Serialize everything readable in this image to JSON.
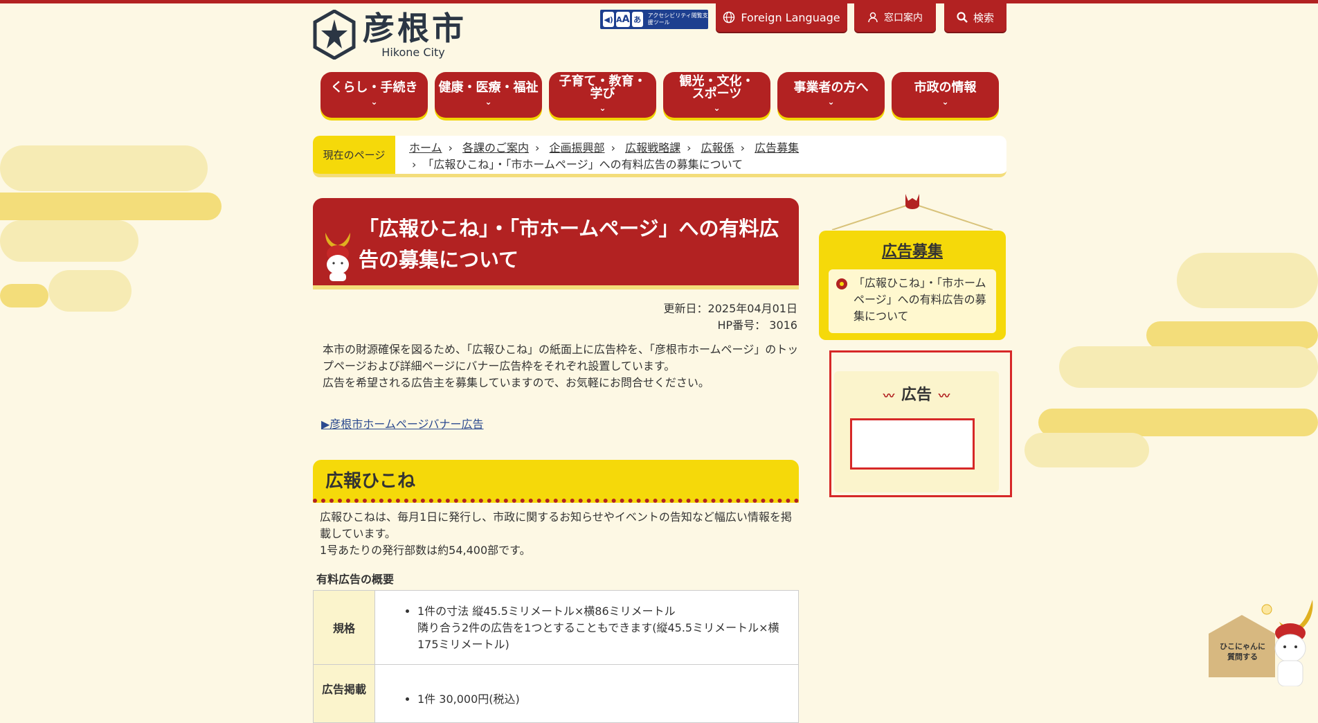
{
  "site": {
    "name_jp": "彦根市",
    "name_en": "Hikone City"
  },
  "header": {
    "a11y_label": "アクセシビリティ閲覧支援ツール",
    "a11y_icon_a": "A",
    "a11y_icon_a2": "A",
    "a11y_icon_kana": "あ",
    "foreign_language": "Foreign Language",
    "counter_guide": "窓口案内",
    "search": "検索"
  },
  "nav": [
    {
      "line1": "くらし・手続き",
      "line2": ""
    },
    {
      "line1": "健康・医療・福祉",
      "line2": ""
    },
    {
      "line1": "子育て・教育・",
      "line2": "学び"
    },
    {
      "line1": "観光・文化・",
      "line2": "スポーツ"
    },
    {
      "line1": "事業者の方へ",
      "line2": ""
    },
    {
      "line1": "市政の情報",
      "line2": ""
    }
  ],
  "breadcrumb": {
    "label": "現在のページ",
    "items": [
      "ホーム",
      "各課のご案内",
      "企画振興部",
      "広報戦略課",
      "広報係",
      "広告募集"
    ],
    "current": "「広報ひこね」・「市ホームページ」への有料広告の募集について"
  },
  "page": {
    "title": "「広報ひこね」・「市ホームページ」への有料広告の募集について",
    "updated": "更新日：2025年04月01日",
    "hp_number": "HP番号： 3016",
    "intro_1": "本市の財源確保を図るため、「広報ひこね」の紙面上に広告枠を、「彦根市ホームページ」のトップページおよび詳細ページにバナー広告枠をそれぞれ設置しています。",
    "intro_2": "広告を希望される広告主を募集していますので、お気軽にお問合せください。",
    "banner_link": "▶彦根市ホームページバナー広告"
  },
  "section": {
    "heading": "広報ひこね",
    "text_1": "広報ひこねは、毎月1日に発行し、市政に関するお知らせやイベントの告知など幅広い情報を掲載しています。",
    "text_2": "1号あたりの発行部数は約54,400部です。",
    "sub_heading": "有料広告の概要",
    "table": [
      {
        "head": "規格",
        "lines": [
          "1件の寸法 縦45.5ミリメートル×横86ミリメートル",
          "隣り合う2件の広告を1つとすることもできます(縦45.5ミリメートル×横175ミリメートル)"
        ]
      },
      {
        "head": "広告掲載",
        "lines": [
          "1件 30,000円(税込)"
        ]
      }
    ]
  },
  "sidebar": {
    "title": "広告募集",
    "items": [
      "「広報ひこね」・「市ホームページ」への有料広告の募集について"
    ],
    "ad_title": "広告"
  },
  "chat": {
    "label_1": "ひこにゃんに",
    "label_2": "質問する"
  },
  "colors": {
    "brand_red": "#b22222",
    "brand_yellow": "#f5d90a",
    "background": "#fdf8e4"
  }
}
